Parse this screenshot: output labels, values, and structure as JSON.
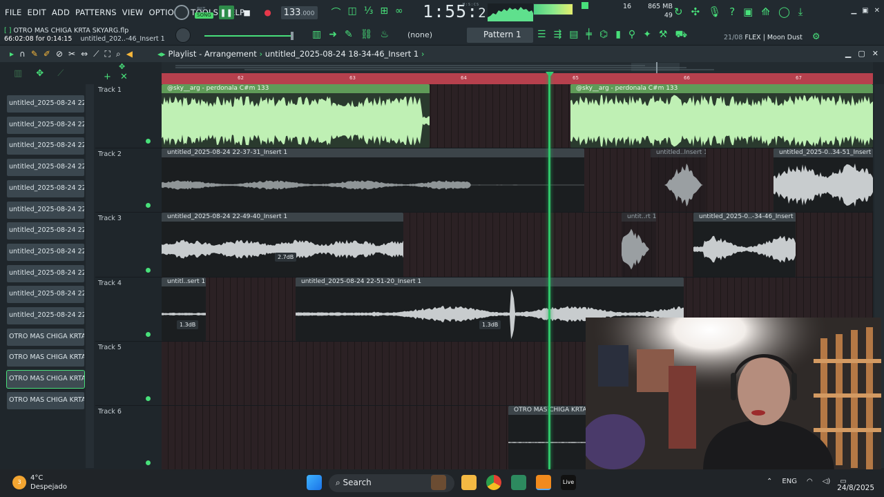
{
  "menu": [
    "FILE",
    "EDIT",
    "ADD",
    "PATTERNS",
    "VIEW",
    "OPTIONS",
    "TOOLS",
    "HELP"
  ],
  "transport": {
    "pat_label": "PAT",
    "song_label": "SONG",
    "bpm": "133",
    "bpm_decimal": ".000"
  },
  "timecode": {
    "main": "1:55",
    "sub": "22",
    "unit": "M:S:CS"
  },
  "sysinfo": {
    "cpu_label": "16",
    "mem": "865 MB",
    "voices": "49"
  },
  "project": {
    "info": "66:02:08 for 0:14:15",
    "name": "OTRO MAS CHIGA KRTA SKYARG.flp",
    "insert": "untitled_202..-46_Insert 1"
  },
  "toolbar2": {
    "none_label": "(none)",
    "pattern": "Pattern 1",
    "news": "21/08",
    "news_text": "FLEX | Moon Dust"
  },
  "playlist": {
    "title": "Playlist - Arrangement",
    "path": "untitled_2025-08-24 18-34-46_Insert 1"
  },
  "ruler": {
    "marks": [
      "62",
      "63",
      "64",
      "65",
      "66",
      "67"
    ]
  },
  "browser": {
    "items": [
      "untitled_2025-08-24 22-...",
      "untitled_2025-08-24 22-...",
      "untitled_2025-08-24 22-...",
      "untitled_2025-08-24 22-...",
      "untitled_2025-08-24 22-...",
      "untitled_2025-08-24 22-...",
      "untitled_2025-08-24 22-...",
      "untitled_2025-08-24 22-...",
      "untitled_2025-08-24 22-...",
      "untitled_2025-08-24 22-...",
      "untitled_2025-08-24 22-...",
      "OTRO MAS CHIGA KRTA SKY...",
      "OTRO MAS CHIGA KRTA SKY...",
      "OTRO MAS CHIGA KRTA SKY...",
      "OTRO MAS CHIGA KRTA SKY..."
    ]
  },
  "tracks": [
    "Track 1",
    "Track 2",
    "Track 3",
    "Track 4",
    "Track 5",
    "Track 6"
  ],
  "clips": {
    "t1a": "@sky__arg - perdonala C#m 133",
    "t1b": "@sky__arg - perdonala C#m 133",
    "t2a": "untitled_2025-08-24 22-37-31_Insert 1",
    "t2b": "untitled..Insert 1",
    "t2c": "untitled_2025-0..34-51_Insert 1",
    "t3a": "untitled_2025-08-24 22-49-40_Insert 1",
    "t3b": "untit..rt 1",
    "t3c": "untitled_2025-0..-34-46_Insert 1",
    "t4a": "untitl..sert 1",
    "t4b": "untitled_2025-08-24 22-51-20_Insert 1",
    "t6a": "OTRO MAS CHIGA KRTA"
  },
  "db": {
    "t3": "2.7dB",
    "t4a": "1.3dB",
    "t4b": "1.3dB"
  },
  "taskbar": {
    "temp": "4°C",
    "weather": "Despejado",
    "search": "Search",
    "live": "Live",
    "lang": "ENG",
    "date": "24/8/2025"
  },
  "colors": {
    "accent": "#48e07a",
    "ruler": "#b6404d",
    "clip_green": "#5f9b58",
    "wave_green": "#bff0b4",
    "wave_gray": "#c8ccce"
  }
}
